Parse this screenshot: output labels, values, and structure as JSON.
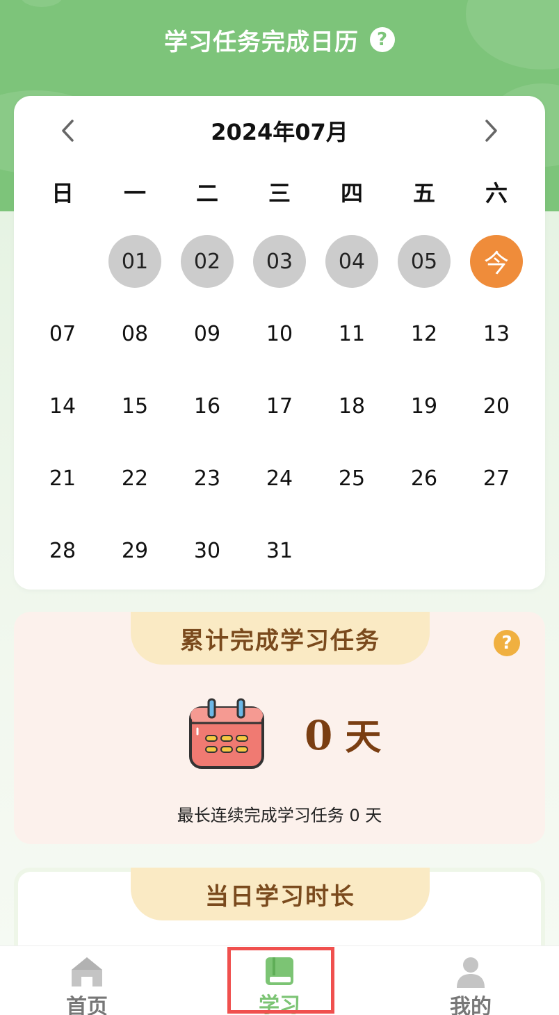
{
  "header": {
    "title": "学习任务完成日历",
    "help_icon": "?"
  },
  "calendar": {
    "month_label": "2024年07月",
    "prev_icon": "chevron-left-icon",
    "next_icon": "chevron-right-icon",
    "weekdays": [
      "日",
      "一",
      "二",
      "三",
      "四",
      "五",
      "六"
    ],
    "today_label": "今",
    "days": [
      {
        "label": "",
        "state": "empty"
      },
      {
        "label": "01",
        "state": "past"
      },
      {
        "label": "02",
        "state": "past"
      },
      {
        "label": "03",
        "state": "past"
      },
      {
        "label": "04",
        "state": "past"
      },
      {
        "label": "05",
        "state": "past"
      },
      {
        "label": "今",
        "state": "today"
      },
      {
        "label": "07",
        "state": "future"
      },
      {
        "label": "08",
        "state": "future"
      },
      {
        "label": "09",
        "state": "future"
      },
      {
        "label": "10",
        "state": "future"
      },
      {
        "label": "11",
        "state": "future"
      },
      {
        "label": "12",
        "state": "future"
      },
      {
        "label": "13",
        "state": "future"
      },
      {
        "label": "14",
        "state": "future"
      },
      {
        "label": "15",
        "state": "future"
      },
      {
        "label": "16",
        "state": "future"
      },
      {
        "label": "17",
        "state": "future"
      },
      {
        "label": "18",
        "state": "future"
      },
      {
        "label": "19",
        "state": "future"
      },
      {
        "label": "20",
        "state": "future"
      },
      {
        "label": "21",
        "state": "future"
      },
      {
        "label": "22",
        "state": "future"
      },
      {
        "label": "23",
        "state": "future"
      },
      {
        "label": "24",
        "state": "future"
      },
      {
        "label": "25",
        "state": "future"
      },
      {
        "label": "26",
        "state": "future"
      },
      {
        "label": "27",
        "state": "future"
      },
      {
        "label": "28",
        "state": "future"
      },
      {
        "label": "29",
        "state": "future"
      },
      {
        "label": "30",
        "state": "future"
      },
      {
        "label": "31",
        "state": "future"
      }
    ]
  },
  "total_card": {
    "title": "累计完成学习任务",
    "help_icon": "?",
    "calendar_icon": "calendar-icon",
    "total_value": "0",
    "total_unit": "天",
    "streak_text": "最长连续完成学习任务 0 天"
  },
  "duration_card": {
    "title": "当日学习时长"
  },
  "tabbar": {
    "items": [
      {
        "label": "首页",
        "icon": "home-icon",
        "active": false
      },
      {
        "label": "学习",
        "icon": "book-icon",
        "active": true
      },
      {
        "label": "我的",
        "icon": "user-icon",
        "active": false
      }
    ]
  },
  "colors": {
    "header_green": "#7dc47a",
    "today_orange": "#ef8c3a",
    "past_gray": "#cccccc",
    "card_pink": "#fcf1ec",
    "tab_yellow": "#faeac4",
    "title_brown": "#7a4a1d",
    "active_tab_green": "#7cc474",
    "highlight_red": "#f0504e"
  }
}
